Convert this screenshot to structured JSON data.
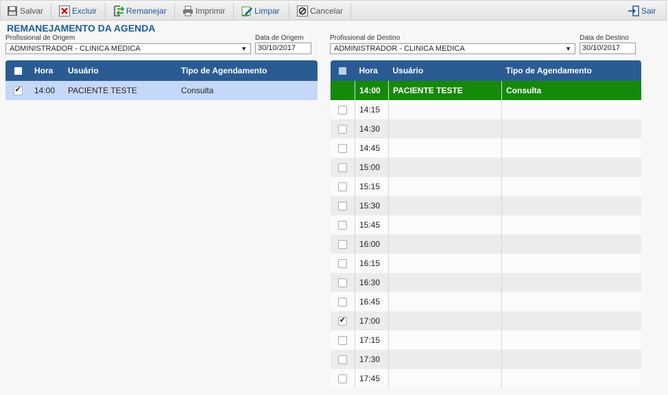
{
  "toolbar": {
    "salvar": "Salvar",
    "excluir": "Excluir",
    "remanejar": "Remanejar",
    "imprimir": "Imprimir",
    "limpar": "Limpar",
    "cancelar": "Cancelar",
    "sair": "Sair"
  },
  "page_title": "REMANEJAMENTO DA AGENDA",
  "origem": {
    "prof_label": "Profissional de Origem",
    "prof_value": "ADMINISTRADOR - CLINICA MEDICA",
    "date_label": "Data de Origem",
    "date_value": "30/10/2017"
  },
  "destino": {
    "prof_label": "Profissional de Destino",
    "prof_value": "ADMINISTRADOR - CLINICA MEDICA",
    "date_label": "Data de Destino",
    "date_value": "30/10/2017"
  },
  "columns": {
    "hora": "Hora",
    "usuario": "Usuário",
    "tipo": "Tipo de Agendamento"
  },
  "left_rows": [
    {
      "hora": "14:00",
      "usuario": "PACIENTE TESTE",
      "tipo": "Consulta",
      "checked": true
    }
  ],
  "right_booked": {
    "hora": "14:00",
    "usuario": "PACIENTE TESTE",
    "tipo": "Consulta"
  },
  "right_slots": [
    {
      "hora": "14:15",
      "checked": false
    },
    {
      "hora": "14:30",
      "checked": false
    },
    {
      "hora": "14:45",
      "checked": false
    },
    {
      "hora": "15:00",
      "checked": false
    },
    {
      "hora": "15:15",
      "checked": false
    },
    {
      "hora": "15:30",
      "checked": false
    },
    {
      "hora": "15:45",
      "checked": false
    },
    {
      "hora": "16:00",
      "checked": false
    },
    {
      "hora": "16:15",
      "checked": false
    },
    {
      "hora": "16:30",
      "checked": false
    },
    {
      "hora": "16:45",
      "checked": false
    },
    {
      "hora": "17:00",
      "checked": true
    },
    {
      "hora": "17:15",
      "checked": false
    },
    {
      "hora": "17:30",
      "checked": false
    },
    {
      "hora": "17:45",
      "checked": false
    }
  ],
  "icons": {
    "salvar": "save-icon",
    "excluir": "delete-x-icon",
    "remanejar": "swap-arrows-icon",
    "imprimir": "printer-icon",
    "limpar": "eraser-icon",
    "cancelar": "cancel-circle-icon",
    "sair": "exit-door-icon"
  },
  "colors": {
    "header_blue": "#2a5c93",
    "title_blue": "#1a5b99",
    "booked_green": "#158a0a",
    "selected_row": "#c6d8f9"
  }
}
